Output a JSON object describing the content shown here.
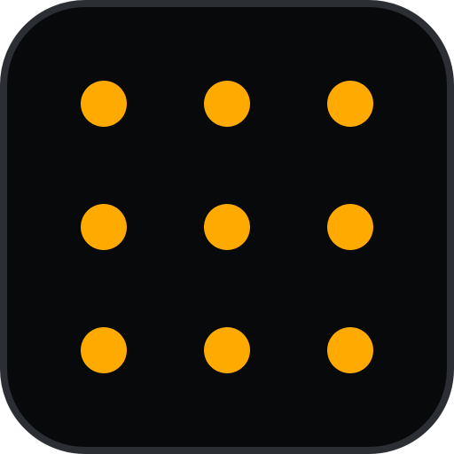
{
  "icon": {
    "name": "nine-dot-grid-icon",
    "colors": {
      "tile_fill": "#08090b",
      "tile_border": "#2b2e32",
      "dot": "#ffaa00"
    },
    "rows": 3,
    "columns": 3
  }
}
